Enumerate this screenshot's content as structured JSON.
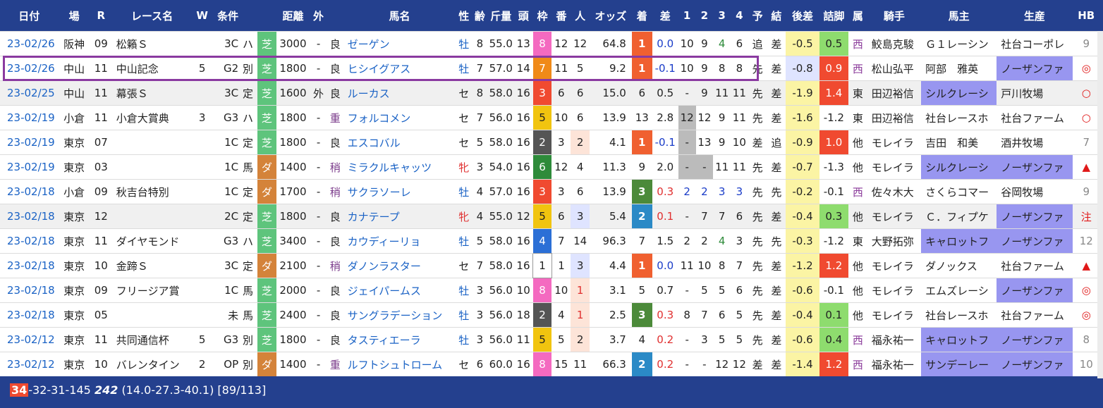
{
  "headers": [
    "日付",
    "場",
    "R",
    "レース名",
    "W",
    "条件",
    "",
    "距離",
    "外",
    "",
    "馬名",
    "性",
    "齢",
    "斤量",
    "頭",
    "枠",
    "番",
    "人",
    "オッズ",
    "着",
    "差",
    "1",
    "2",
    "3",
    "4",
    "予",
    "結",
    "後差",
    "詰脚",
    "属",
    "騎手",
    "馬主",
    "生産",
    "HB"
  ],
  "colors": {
    "waku1": "#ffffff",
    "waku2": "#555555",
    "waku3": "#f04a30",
    "waku4": "#2b6fd6",
    "waku5": "#f1c40f",
    "waku6": "#2e8b3a",
    "waku7": "#f08a18",
    "waku8": "#f46ac0",
    "fin1": "#f06030",
    "fin2": "#2b8ac6",
    "fin3": "#4c8a3a"
  },
  "rows": [
    {
      "date": "23-02/26",
      "place": "阪神",
      "r": "09",
      "race": "松籟Ｓ",
      "w": "",
      "grade": "3C",
      "class": "ハ",
      "surface": "芝",
      "dist": "3000",
      "out": "-",
      "cond": "良",
      "horse": "ゼーゲン",
      "sex": "牡",
      "age": "8",
      "weight": "55.0",
      "heads": "13",
      "waku": "8",
      "ban": "12",
      "pop": "12",
      "odds": "64.8",
      "fin": "1",
      "diff": "0.0",
      "c1": "10",
      "c2": "9",
      "c3": "4",
      "c4": "6",
      "yo": "追",
      "ketsu": "差",
      "atosa": "-0.5",
      "tsume": "0.5",
      "zoku": "西",
      "jockey": "鮫島克駿",
      "owner": "Ｇ１レーシン",
      "breeder": "社台コーポレ",
      "hb": "9"
    },
    {
      "date": "23-02/26",
      "place": "中山",
      "r": "11",
      "race": "中山記念",
      "w": "5",
      "grade": "G2",
      "class": "別",
      "surface": "芝",
      "dist": "1800",
      "out": "-",
      "cond": "良",
      "horse": "ヒシイグアス",
      "sex": "牡",
      "age": "7",
      "weight": "57.0",
      "heads": "14",
      "waku": "7",
      "ban": "11",
      "pop": "5",
      "odds": "9.2",
      "fin": "1",
      "diff": "-0.1",
      "c1": "10",
      "c2": "9",
      "c3": "8",
      "c4": "8",
      "yo": "先",
      "ketsu": "差",
      "atosa": "-0.8",
      "tsume": "0.9",
      "zoku": "西",
      "jockey": "松山弘平",
      "owner": "阿部　雅英",
      "breeder": "ノーザンファ",
      "hb": "◎"
    },
    {
      "date": "23-02/25",
      "place": "中山",
      "r": "11",
      "race": "幕張Ｓ",
      "w": "",
      "grade": "3C",
      "class": "定",
      "surface": "芝",
      "dist": "1600",
      "out": "外",
      "cond": "良",
      "horse": "ルーカス",
      "sex": "セ",
      "age": "8",
      "weight": "58.0",
      "heads": "16",
      "waku": "3",
      "ban": "6",
      "pop": "6",
      "odds": "15.0",
      "fin": "6",
      "diff": "0.5",
      "c1": "-",
      "c2": "9",
      "c3": "11",
      "c4": "11",
      "yo": "先",
      "ketsu": "差",
      "atosa": "-1.9",
      "tsume": "1.4",
      "zoku": "東",
      "jockey": "田辺裕信",
      "owner": "シルクレーシ",
      "breeder": "戸川牧場",
      "hb": "○"
    },
    {
      "date": "23-02/19",
      "place": "小倉",
      "r": "11",
      "race": "小倉大賞典",
      "w": "3",
      "grade": "G3",
      "class": "ハ",
      "surface": "芝",
      "dist": "1800",
      "out": "-",
      "cond": "重",
      "horse": "フォルコメン",
      "sex": "セ",
      "age": "7",
      "weight": "56.0",
      "heads": "16",
      "waku": "5",
      "ban": "10",
      "pop": "6",
      "odds": "13.9",
      "fin": "13",
      "diff": "2.8",
      "c1": "12",
      "c2": "12",
      "c3": "9",
      "c4": "11",
      "yo": "先",
      "ketsu": "差",
      "atosa": "-1.6",
      "tsume": "-1.2",
      "zoku": "東",
      "jockey": "田辺裕信",
      "owner": "社台レースホ",
      "breeder": "社台ファーム",
      "hb": "○"
    },
    {
      "date": "23-02/19",
      "place": "東京",
      "r": "07",
      "race": "",
      "w": "",
      "grade": "1C",
      "class": "定",
      "surface": "芝",
      "dist": "1800",
      "out": "-",
      "cond": "良",
      "horse": "エスコバル",
      "sex": "セ",
      "age": "5",
      "weight": "58.0",
      "heads": "16",
      "waku": "2",
      "ban": "3",
      "pop": "2",
      "odds": "4.1",
      "fin": "1",
      "diff": "-0.1",
      "c1": "-",
      "c2": "13",
      "c3": "9",
      "c4": "10",
      "yo": "差",
      "ketsu": "追",
      "atosa": "-0.9",
      "tsume": "1.0",
      "zoku": "他",
      "jockey": "モレイラ",
      "owner": "吉田　和美",
      "breeder": "酒井牧場",
      "hb": "7"
    },
    {
      "date": "23-02/19",
      "place": "東京",
      "r": "03",
      "race": "",
      "w": "",
      "grade": "1C",
      "class": "馬",
      "surface": "ダ",
      "dist": "1400",
      "out": "-",
      "cond": "稍",
      "horse": "ミラクルキャッツ",
      "sex": "牝",
      "age": "3",
      "weight": "54.0",
      "heads": "16",
      "waku": "6",
      "ban": "12",
      "pop": "4",
      "odds": "11.3",
      "fin": "9",
      "diff": "2.0",
      "c1": "-",
      "c2": "-",
      "c3": "11",
      "c4": "11",
      "yo": "先",
      "ketsu": "差",
      "atosa": "-0.7",
      "tsume": "-1.3",
      "zoku": "他",
      "jockey": "モレイラ",
      "owner": "シルクレーシ",
      "breeder": "ノーザンファ",
      "hb": "▲"
    },
    {
      "date": "23-02/18",
      "place": "小倉",
      "r": "09",
      "race": "秋吉台特別",
      "w": "",
      "grade": "1C",
      "class": "定",
      "surface": "ダ",
      "dist": "1700",
      "out": "-",
      "cond": "稍",
      "horse": "サクラソーレ",
      "sex": "牡",
      "age": "4",
      "weight": "57.0",
      "heads": "16",
      "waku": "3",
      "ban": "3",
      "pop": "6",
      "odds": "13.9",
      "fin": "3",
      "diff": "0.3",
      "c1": "2",
      "c2": "2",
      "c3": "3",
      "c4": "3",
      "yo": "先",
      "ketsu": "先",
      "atosa": "-0.2",
      "tsume": "-0.1",
      "zoku": "西",
      "jockey": "佐々木大",
      "owner": "さくらコマー",
      "breeder": "谷岡牧場",
      "hb": "9"
    },
    {
      "date": "23-02/18",
      "place": "東京",
      "r": "12",
      "race": "",
      "w": "",
      "grade": "2C",
      "class": "定",
      "surface": "芝",
      "dist": "1800",
      "out": "-",
      "cond": "良",
      "horse": "カナテープ",
      "sex": "牝",
      "age": "4",
      "weight": "55.0",
      "heads": "12",
      "waku": "5",
      "ban": "6",
      "pop": "3",
      "odds": "5.4",
      "fin": "2",
      "diff": "0.1",
      "c1": "-",
      "c2": "7",
      "c3": "7",
      "c4": "6",
      "yo": "先",
      "ketsu": "差",
      "atosa": "-0.4",
      "tsume": "0.3",
      "zoku": "他",
      "jockey": "モレイラ",
      "owner": "Ｃ．フィプケ",
      "breeder": "ノーザンファ",
      "hb": "注"
    },
    {
      "date": "23-02/18",
      "place": "東京",
      "r": "11",
      "race": "ダイヤモンド",
      "w": "",
      "grade": "G3",
      "class": "ハ",
      "surface": "芝",
      "dist": "3400",
      "out": "-",
      "cond": "良",
      "horse": "カウディーリョ",
      "sex": "牡",
      "age": "5",
      "weight": "58.0",
      "heads": "16",
      "waku": "4",
      "ban": "7",
      "pop": "14",
      "odds": "96.3",
      "fin": "7",
      "diff": "1.5",
      "c1": "2",
      "c2": "2",
      "c3": "4",
      "c4": "3",
      "yo": "先",
      "ketsu": "先",
      "atosa": "-0.3",
      "tsume": "-1.2",
      "zoku": "東",
      "jockey": "大野拓弥",
      "owner": "キャロットフ",
      "breeder": "ノーザンファ",
      "hb": "12"
    },
    {
      "date": "23-02/18",
      "place": "東京",
      "r": "10",
      "race": "金蹄Ｓ",
      "w": "",
      "grade": "3C",
      "class": "定",
      "surface": "ダ",
      "dist": "2100",
      "out": "-",
      "cond": "稍",
      "horse": "ダノンラスター",
      "sex": "セ",
      "age": "7",
      "weight": "58.0",
      "heads": "16",
      "waku": "1",
      "ban": "1",
      "pop": "3",
      "odds": "4.4",
      "fin": "1",
      "diff": "0.0",
      "c1": "11",
      "c2": "10",
      "c3": "8",
      "c4": "7",
      "yo": "先",
      "ketsu": "差",
      "atosa": "-1.2",
      "tsume": "1.2",
      "zoku": "他",
      "jockey": "モレイラ",
      "owner": "ダノックス",
      "breeder": "社台ファーム",
      "hb": "▲"
    },
    {
      "date": "23-02/18",
      "place": "東京",
      "r": "09",
      "race": "フリージア賞",
      "w": "",
      "grade": "1C",
      "class": "馬",
      "surface": "芝",
      "dist": "2000",
      "out": "-",
      "cond": "良",
      "horse": "ジェイパームス",
      "sex": "牡",
      "age": "3",
      "weight": "56.0",
      "heads": "10",
      "waku": "8",
      "ban": "10",
      "pop": "1",
      "odds": "3.1",
      "fin": "5",
      "diff": "0.7",
      "c1": "-",
      "c2": "5",
      "c3": "5",
      "c4": "6",
      "yo": "先",
      "ketsu": "差",
      "atosa": "-0.6",
      "tsume": "-0.1",
      "zoku": "他",
      "jockey": "モレイラ",
      "owner": "エムズレーシ",
      "breeder": "ノーザンファ",
      "hb": "◎"
    },
    {
      "date": "23-02/18",
      "place": "東京",
      "r": "05",
      "race": "",
      "w": "",
      "grade": "未",
      "class": "馬",
      "surface": "芝",
      "dist": "2400",
      "out": "-",
      "cond": "良",
      "horse": "サングラデーション",
      "sex": "牡",
      "age": "3",
      "weight": "56.0",
      "heads": "18",
      "waku": "2",
      "ban": "4",
      "pop": "1",
      "odds": "2.5",
      "fin": "3",
      "diff": "0.3",
      "c1": "8",
      "c2": "7",
      "c3": "6",
      "c4": "5",
      "yo": "先",
      "ketsu": "差",
      "atosa": "-0.4",
      "tsume": "0.1",
      "zoku": "他",
      "jockey": "モレイラ",
      "owner": "社台レースホ",
      "breeder": "社台ファーム",
      "hb": "◎"
    },
    {
      "date": "23-02/12",
      "place": "東京",
      "r": "11",
      "race": "共同通信杯",
      "w": "5",
      "grade": "G3",
      "class": "別",
      "surface": "芝",
      "dist": "1800",
      "out": "-",
      "cond": "良",
      "horse": "タスティエーラ",
      "sex": "牡",
      "age": "3",
      "weight": "56.0",
      "heads": "11",
      "waku": "5",
      "ban": "5",
      "pop": "2",
      "odds": "3.7",
      "fin": "4",
      "diff": "0.2",
      "c1": "-",
      "c2": "3",
      "c3": "5",
      "c4": "5",
      "yo": "先",
      "ketsu": "差",
      "atosa": "-0.6",
      "tsume": "0.4",
      "zoku": "西",
      "jockey": "福永祐一",
      "owner": "キャロットフ",
      "breeder": "ノーザンファ",
      "hb": "8"
    },
    {
      "date": "23-02/12",
      "place": "東京",
      "r": "10",
      "race": "バレンタイン",
      "w": "2",
      "grade": "OP",
      "class": "別",
      "surface": "ダ",
      "dist": "1400",
      "out": "-",
      "cond": "重",
      "horse": "ルフトシュトローム",
      "sex": "セ",
      "age": "6",
      "weight": "60.0",
      "heads": "16",
      "waku": "8",
      "ban": "15",
      "pop": "11",
      "odds": "66.3",
      "fin": "2",
      "diff": "0.2",
      "c1": "-",
      "c2": "-",
      "c3": "12",
      "c4": "12",
      "yo": "差",
      "ketsu": "差",
      "atosa": "-1.4",
      "tsume": "1.2",
      "zoku": "西",
      "jockey": "福永祐一",
      "owner": "サンデーレー",
      "breeder": "ノーザンファ",
      "hb": "10"
    }
  ],
  "footer": {
    "badge": "34",
    "rest": "-32-31-145",
    "bold": "242",
    "tail": "(14.0-27.3-40.1) [89/113]"
  }
}
